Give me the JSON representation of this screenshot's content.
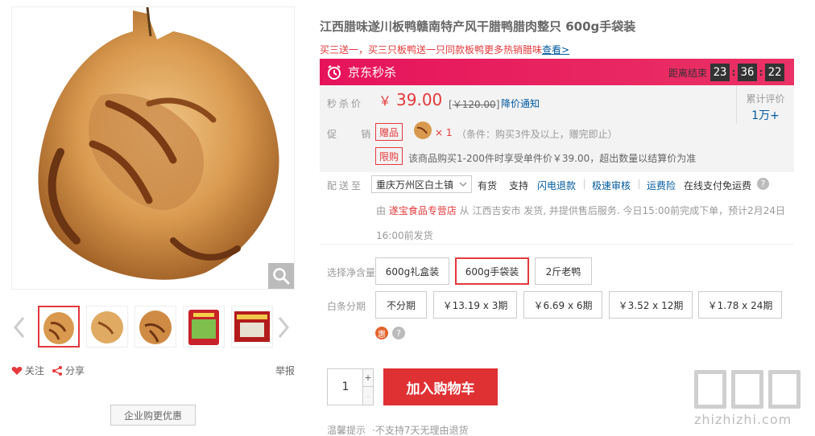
{
  "product": {
    "title": "江西腊味遂川板鸭赣南特产风干腊鸭腊肉整只 600g手袋装",
    "promo_text": "买三送一，买三只板鸭送一只同款板鸭更多热销腊味",
    "promo_link": "查看>"
  },
  "gallery": {
    "zoom_icon": "magnifier-icon",
    "thumbnail_count": 5,
    "active_thumbnail": 0
  },
  "social": {
    "follow": "关注",
    "share": "分享",
    "report": "举报"
  },
  "corporate_button": "企业购更优惠",
  "seckill": {
    "brand": "京东秒杀",
    "countdown_label": "距离结束",
    "hours": "23",
    "minutes": "36",
    "seconds": "22",
    "colors": {
      "bar_start": "#e6135b",
      "bar_end": "#ea3266"
    }
  },
  "pricing": {
    "label": "秒杀价",
    "currency": "￥",
    "price": "39.00",
    "original_prefix": "[",
    "original": "￥120.00",
    "original_suffix": "]",
    "notify": "降价通知",
    "review_label": "累计评价",
    "review_count": "1万+"
  },
  "promotions": {
    "label": "促销",
    "gift_tag": "赠品",
    "gift_count": "× 1",
    "gift_condition": "（条件：购买3件及以上，赠完即止）",
    "limit_tag": "限购",
    "limit_text": "该商品购买1-200件时享受单件价￥39.00，超出数量以结算价为准"
  },
  "delivery": {
    "label": "配送至",
    "address": "重庆万州区白土镇",
    "stock": "有货",
    "support": "支持",
    "services": [
      "闪电退款",
      "极速审核",
      "运费险"
    ],
    "pay_on_delivery": "在线支付免运费",
    "ship_prefix": "由 ",
    "shop_name": "遂宝食品专营店",
    "ship_text": " 从 江西吉安市 发货, 并提供售后服务. 今日15:00前完成下单，预计2月24日16:00前发货"
  },
  "options": {
    "weight_label": "选择净含量",
    "weights": [
      "600g礼盒装",
      "600g手袋装",
      "2斤老鸭"
    ],
    "selected_weight": "600g手袋装",
    "installment_label": "白条分期",
    "installments": [
      "不分期",
      "￥13.19 x 3期",
      "￥6.69 x 6期",
      "￥3.52 x 12期",
      "￥1.78 x 24期"
    ],
    "hui_label": "惠"
  },
  "cart": {
    "quantity": "1",
    "plus": "+",
    "minus": "-",
    "add_to_cart": "加入购物车"
  },
  "tips": {
    "label": "温馨提示",
    "text": "·不支持7天无理由退货"
  },
  "watermark": {
    "text": "zhizhizhi.com"
  },
  "colors": {
    "accent_red": "#e4393c",
    "link_blue": "#005aa0",
    "cart_red": "#df3033"
  }
}
